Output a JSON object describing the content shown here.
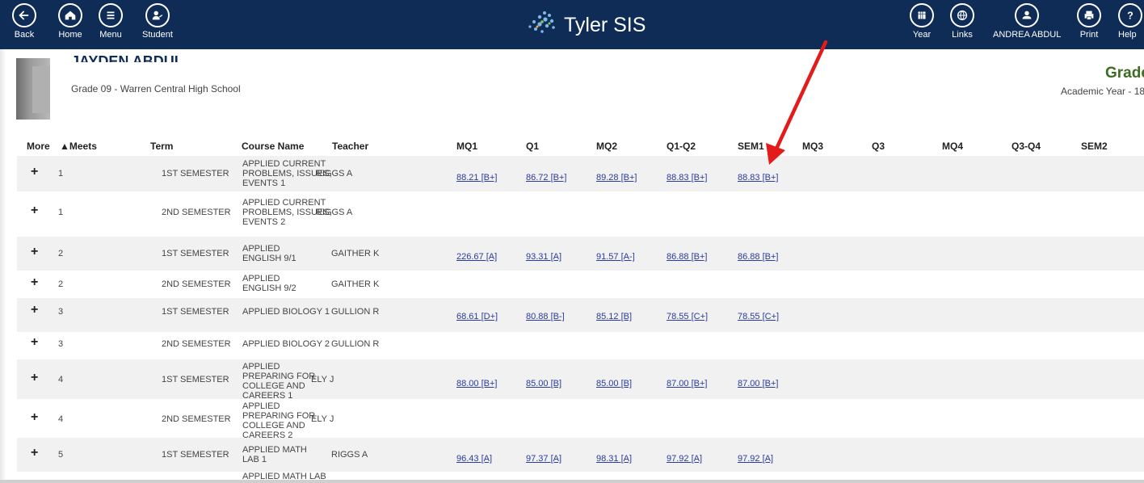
{
  "nav": {
    "back": "Back",
    "home": "Home",
    "menu": "Menu",
    "student": "Student",
    "brand": "Tyler SIS",
    "year": "Year",
    "links": "Links",
    "user": "ANDREA ABDUL",
    "print": "Print",
    "help": "Help"
  },
  "student": {
    "name": "JAYDEN ABDUL",
    "grade_school": "Grade 09 - Warren Central High School"
  },
  "page": {
    "title": "Grades",
    "academic_year": "Academic Year - 18"
  },
  "columns": {
    "more": "More",
    "meets": "▲Meets",
    "term": "Term",
    "course": "Course Name",
    "teacher": "Teacher",
    "mq1": "MQ1",
    "q1": "Q1",
    "mq2": "MQ2",
    "q1q2": "Q1-Q2",
    "sem1": "SEM1",
    "mq3": "MQ3",
    "q3": "Q3",
    "mq4": "MQ4",
    "q3q4": "Q3-Q4",
    "sem2": "SEM2"
  },
  "rows": [
    {
      "meets": "1",
      "term": "1ST SEMESTER",
      "course": "APPLIED CURRENT PROBLEMS, ISSUES, EVENTS 1",
      "teacher": "RIGGS A",
      "mq1": "88.21 [B+]",
      "q1": "86.72 [B+]",
      "mq2": "89.28 [B+]",
      "q1q2": "88.83 [B+]",
      "sem1": "88.83 [B+]"
    },
    {
      "meets": "1",
      "term": "2ND SEMESTER",
      "course": "APPLIED CURRENT PROBLEMS, ISSUES, EVENTS 2",
      "teacher": "RIGGS A",
      "mq1": "",
      "q1": "",
      "mq2": "",
      "q1q2": "",
      "sem1": ""
    },
    {
      "meets": "2",
      "term": "1ST SEMESTER",
      "course": "APPLIED ENGLISH 9/1",
      "teacher": "GAITHER K",
      "mq1": "226.67 [A]",
      "q1": "93.31 [A]",
      "mq2": "91.57 [A-]",
      "q1q2": "86.88 [B+]",
      "sem1": "86.88 [B+]"
    },
    {
      "meets": "2",
      "term": "2ND SEMESTER",
      "course": "APPLIED ENGLISH 9/2",
      "teacher": "GAITHER K",
      "mq1": "",
      "q1": "",
      "mq2": "",
      "q1q2": "",
      "sem1": ""
    },
    {
      "meets": "3",
      "term": "1ST SEMESTER",
      "course": "APPLIED BIOLOGY 1",
      "teacher": "GULLION R",
      "mq1": "68.61 [D+]",
      "q1": "80.88 [B-]",
      "mq2": "85.12 [B]",
      "q1q2": "78.55 [C+]",
      "sem1": "78.55 [C+]"
    },
    {
      "meets": "3",
      "term": "2ND SEMESTER",
      "course": "APPLIED BIOLOGY 2",
      "teacher": "GULLION R",
      "mq1": "",
      "q1": "",
      "mq2": "",
      "q1q2": "",
      "sem1": ""
    },
    {
      "meets": "4",
      "term": "1ST SEMESTER",
      "course": "APPLIED PREPARING FOR COLLEGE AND CAREERS 1",
      "teacher": "ELY J",
      "mq1": "88.00 [B+]",
      "q1": "85.00 [B]",
      "mq2": "85.00 [B]",
      "q1q2": "87.00 [B+]",
      "sem1": "87.00 [B+]"
    },
    {
      "meets": "4",
      "term": "2ND SEMESTER",
      "course": "APPLIED PREPARING FOR COLLEGE AND CAREERS 2",
      "teacher": "ELY J",
      "mq1": "",
      "q1": "",
      "mq2": "",
      "q1q2": "",
      "sem1": ""
    },
    {
      "meets": "5",
      "term": "1ST SEMESTER",
      "course": "APPLIED MATH LAB 1",
      "teacher": "RIGGS A",
      "mq1": "96.43 [A]",
      "q1": "97.37 [A]",
      "mq2": "98.31 [A]",
      "q1q2": "97.92 [A]",
      "sem1": "97.92 [A]"
    },
    {
      "meets": "",
      "term": "",
      "course": "APPLIED MATH LAB",
      "teacher": "",
      "mq1": "",
      "q1": "",
      "mq2": "",
      "q1q2": "",
      "sem1": ""
    }
  ],
  "colors": {
    "nav_bg": "#0f2c57",
    "link": "#2a3b9c",
    "title_green": "#3f6b25",
    "arrow": "#e41b1b"
  }
}
